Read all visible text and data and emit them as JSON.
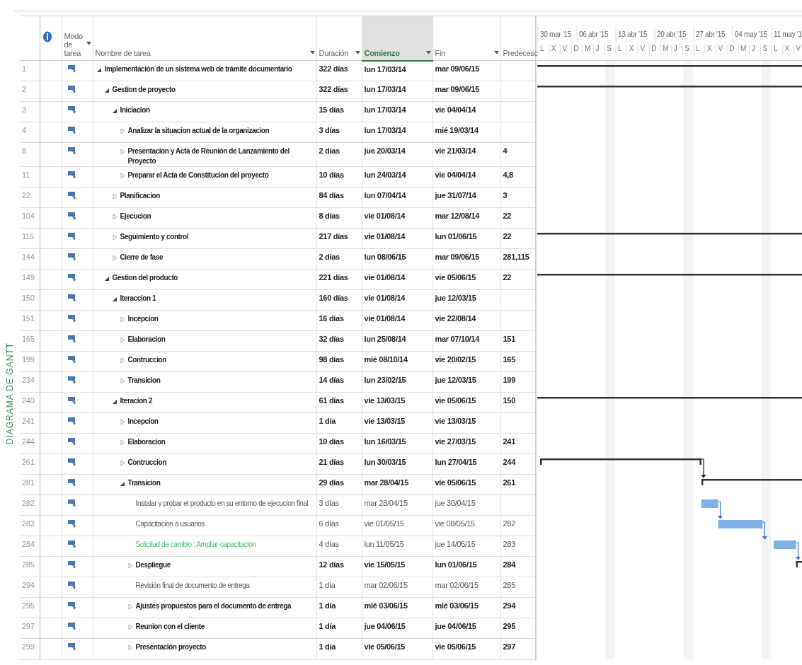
{
  "side_label": "DIAGRAMA DE GANTT",
  "columns": [
    {
      "label": "Modo de tarea",
      "has_menu": true,
      "selected": false
    },
    {
      "label": "Nombre de tarea",
      "has_menu": true,
      "selected": false
    },
    {
      "label": "Duración",
      "has_menu": true,
      "selected": false
    },
    {
      "label": "Comienzo",
      "has_menu": true,
      "selected": true
    },
    {
      "label": "Fin",
      "has_menu": true,
      "selected": false
    },
    {
      "label": "Predecesc",
      "has_menu": false,
      "selected": false
    }
  ],
  "timescale": {
    "weeks": [
      "30 mar '15",
      "06 abr '15",
      "13 abr '15",
      "20 abr '15",
      "27 abr '15",
      "04 may '15",
      "11 may '1"
    ],
    "days": [
      "L",
      "X",
      "V",
      "D",
      "M",
      "J",
      "S",
      "L",
      "X",
      "V",
      "D",
      "M",
      "J",
      "S",
      "L",
      "X",
      "V",
      "D",
      "M",
      "J",
      "S",
      "L",
      "X",
      "V"
    ]
  },
  "rows": [
    {
      "id": "1",
      "name": "Implementación de un sistema web de trámite documentario",
      "kind": "summary",
      "expanded": true,
      "duration": "322 días",
      "start": "lun 17/03/14",
      "finish": "mar 09/06/15",
      "children": [
        {
          "id": "2",
          "name": "Gestion de proyecto",
          "kind": "summary",
          "expanded": true,
          "duration": "322 días",
          "start": "lun 17/03/14",
          "finish": "mar 09/06/15",
          "children": [
            {
              "id": "3",
              "name": "Iniciacion",
              "kind": "summary",
              "expanded": true,
              "duration": "15 días",
              "start": "lun 17/03/14",
              "finish": "vie 04/04/14",
              "children": [
                {
                  "id": "4",
                  "name": "Analizar la situacion actual de la organizacion",
                  "kind": "summary",
                  "expanded": false,
                  "duration": "3 días",
                  "start": "lun 17/03/14",
                  "finish": "mié 19/03/14"
                },
                {
                  "id": "8",
                  "name": "Presentacion y Acta de Reunión de Lanzamiento del Proyecto",
                  "kind": "summary",
                  "expanded": false,
                  "duration": "2 días",
                  "start": "jue 20/03/14",
                  "finish": "vie 21/03/14",
                  "predecessors": "4"
                },
                {
                  "id": "11",
                  "name": "Preparar el Acta de Constitucion del proyecto",
                  "kind": "summary",
                  "expanded": false,
                  "duration": "10 días",
                  "start": "lun 24/03/14",
                  "finish": "vie 04/04/14",
                  "predecessors": "4,8"
                }
              ]
            },
            {
              "id": "22",
              "name": "Planificacion",
              "kind": "summary",
              "expanded": false,
              "duration": "84 días",
              "start": "lun 07/04/14",
              "finish": "jue 31/07/14",
              "predecessors": "3"
            },
            {
              "id": "104",
              "name": "Ejecucion",
              "kind": "summary",
              "expanded": false,
              "duration": "8 días",
              "start": "vie 01/08/14",
              "finish": "mar 12/08/14",
              "predecessors": "22"
            },
            {
              "id": "115",
              "name": "Seguimiento y control",
              "kind": "summary",
              "expanded": false,
              "duration": "217 días",
              "start": "vie 01/08/14",
              "finish": "lun 01/06/15",
              "predecessors": "22"
            },
            {
              "id": "144",
              "name": "Cierre de fase",
              "kind": "summary",
              "expanded": false,
              "duration": "2 días",
              "start": "lun 08/06/15",
              "finish": "mar 09/06/15",
              "predecessors": "281,115"
            }
          ]
        },
        {
          "id": "149",
          "name": "Gestion del producto",
          "kind": "summary",
          "expanded": true,
          "duration": "221 días",
          "start": "vie 01/08/14",
          "finish": "vie 05/06/15",
          "predecessors": "22",
          "children": [
            {
              "id": "150",
              "name": "Iteraccion 1",
              "kind": "summary",
              "expanded": true,
              "duration": "160 días",
              "start": "vie 01/08/14",
              "finish": "jue 12/03/15",
              "children": [
                {
                  "id": "151",
                  "name": "Incepcion",
                  "kind": "summary",
                  "expanded": false,
                  "duration": "16 días",
                  "start": "vie 01/08/14",
                  "finish": "vie 22/08/14"
                },
                {
                  "id": "165",
                  "name": "Elaboracion",
                  "kind": "summary",
                  "expanded": false,
                  "duration": "32 días",
                  "start": "lun 25/08/14",
                  "finish": "mar 07/10/14",
                  "predecessors": "151"
                },
                {
                  "id": "199",
                  "name": "Contruccion",
                  "kind": "summary",
                  "expanded": false,
                  "duration": "98 días",
                  "start": "mié 08/10/14",
                  "finish": "vie 20/02/15",
                  "predecessors": "165"
                },
                {
                  "id": "234",
                  "name": "Transicion",
                  "kind": "summary",
                  "expanded": false,
                  "duration": "14 días",
                  "start": "lun 23/02/15",
                  "finish": "jue 12/03/15",
                  "predecessors": "199"
                }
              ]
            },
            {
              "id": "240",
              "name": "Iteracion 2",
              "kind": "summary",
              "expanded": true,
              "duration": "61 días",
              "start": "vie 13/03/15",
              "finish": "vie 05/06/15",
              "predecessors": "150",
              "children": [
                {
                  "id": "241",
                  "name": "Incepcion",
                  "kind": "summary",
                  "expanded": false,
                  "duration": "1 día",
                  "start": "vie 13/03/15",
                  "finish": "vie 13/03/15"
                },
                {
                  "id": "244",
                  "name": "Elaboracion",
                  "kind": "summary",
                  "expanded": false,
                  "duration": "10 días",
                  "start": "lun 16/03/15",
                  "finish": "vie 27/03/15",
                  "predecessors": "241"
                },
                {
                  "id": "261",
                  "name": "Contruccion",
                  "kind": "summary",
                  "expanded": false,
                  "duration": "21 días",
                  "start": "lun 30/03/15",
                  "finish": "lun 27/04/15",
                  "predecessors": "244"
                },
                {
                  "id": "281",
                  "name": "Transicion",
                  "kind": "summary",
                  "expanded": true,
                  "duration": "29 días",
                  "start": "mar 28/04/15",
                  "finish": "vie 05/06/15",
                  "predecessors": "261",
                  "children": [
                    {
                      "id": "282",
                      "name": "Instalar y probar el producto en su entorno de ejecucion final",
                      "kind": "task",
                      "duration": "3 días",
                      "start": "mar 28/04/15",
                      "finish": "jue 30/04/15"
                    },
                    {
                      "id": "283",
                      "name": "Capacitacion a usuarios",
                      "kind": "task",
                      "duration": "6 días",
                      "start": "vie 01/05/15",
                      "finish": "vie 08/05/15",
                      "predecessors": "282"
                    },
                    {
                      "id": "284",
                      "name": "Solicitud de cambio : Ampliar capacitación",
                      "kind": "change",
                      "duration": "4 días",
                      "start": "lun 11/05/15",
                      "finish": "jue 14/05/15",
                      "predecessors": "283"
                    },
                    {
                      "id": "285",
                      "name": "Despliegue",
                      "kind": "summary",
                      "expanded": false,
                      "duration": "12 días",
                      "start": "vie 15/05/15",
                      "finish": "lun 01/06/15",
                      "predecessors": "284"
                    },
                    {
                      "id": "294",
                      "name": "Revisión final de documento de entrega",
                      "kind": "task",
                      "duration": "1 día",
                      "start": "mar 02/06/15",
                      "finish": "mar 02/06/15",
                      "predecessors": "285"
                    },
                    {
                      "id": "295",
                      "name": "Ajustes propuestos para el documento de entrega",
                      "kind": "summary",
                      "expanded": false,
                      "duration": "1 día",
                      "start": "mié 03/06/15",
                      "finish": "mié 03/06/15",
                      "predecessors": "294"
                    },
                    {
                      "id": "297",
                      "name": "Reunion con el cliente",
                      "kind": "summary",
                      "expanded": false,
                      "duration": "1 día",
                      "start": "jue 04/06/15",
                      "finish": "jue 04/06/15",
                      "predecessors": "295"
                    },
                    {
                      "id": "299",
                      "name": "Presentación proyecto",
                      "kind": "summary",
                      "expanded": false,
                      "duration": "1 día",
                      "start": "vie 05/06/15",
                      "finish": "vie 05/06/15",
                      "predecessors": "297"
                    }
                  ]
                }
              ]
            }
          ]
        }
      ]
    }
  ]
}
